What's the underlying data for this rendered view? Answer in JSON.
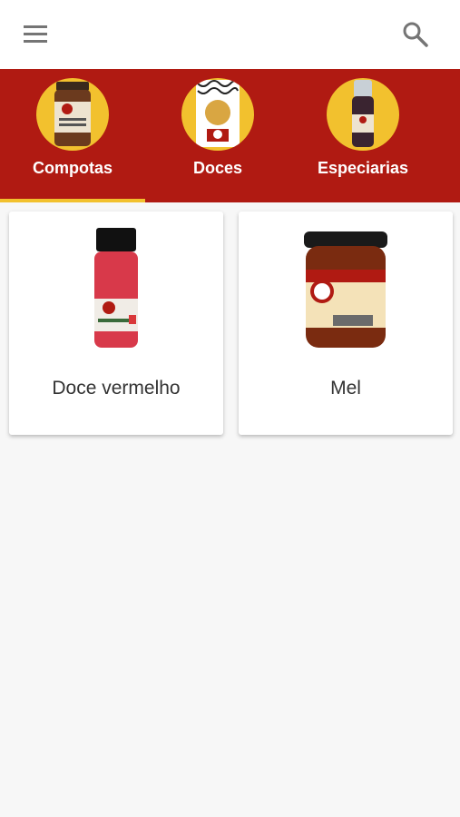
{
  "header": {
    "menu_icon": "hamburger-menu-icon",
    "search_icon": "search-icon"
  },
  "tabs": [
    {
      "label": "Compotas",
      "selected": true
    },
    {
      "label": "Doces",
      "selected": false
    },
    {
      "label": "Especiarias",
      "selected": false
    }
  ],
  "products": [
    {
      "name": "Doce vermelho"
    },
    {
      "name": "Mel"
    }
  ],
  "colors": {
    "tab_bar_bg": "#b01a12",
    "accent": "#f2c12e",
    "background": "#f7f7f7"
  }
}
